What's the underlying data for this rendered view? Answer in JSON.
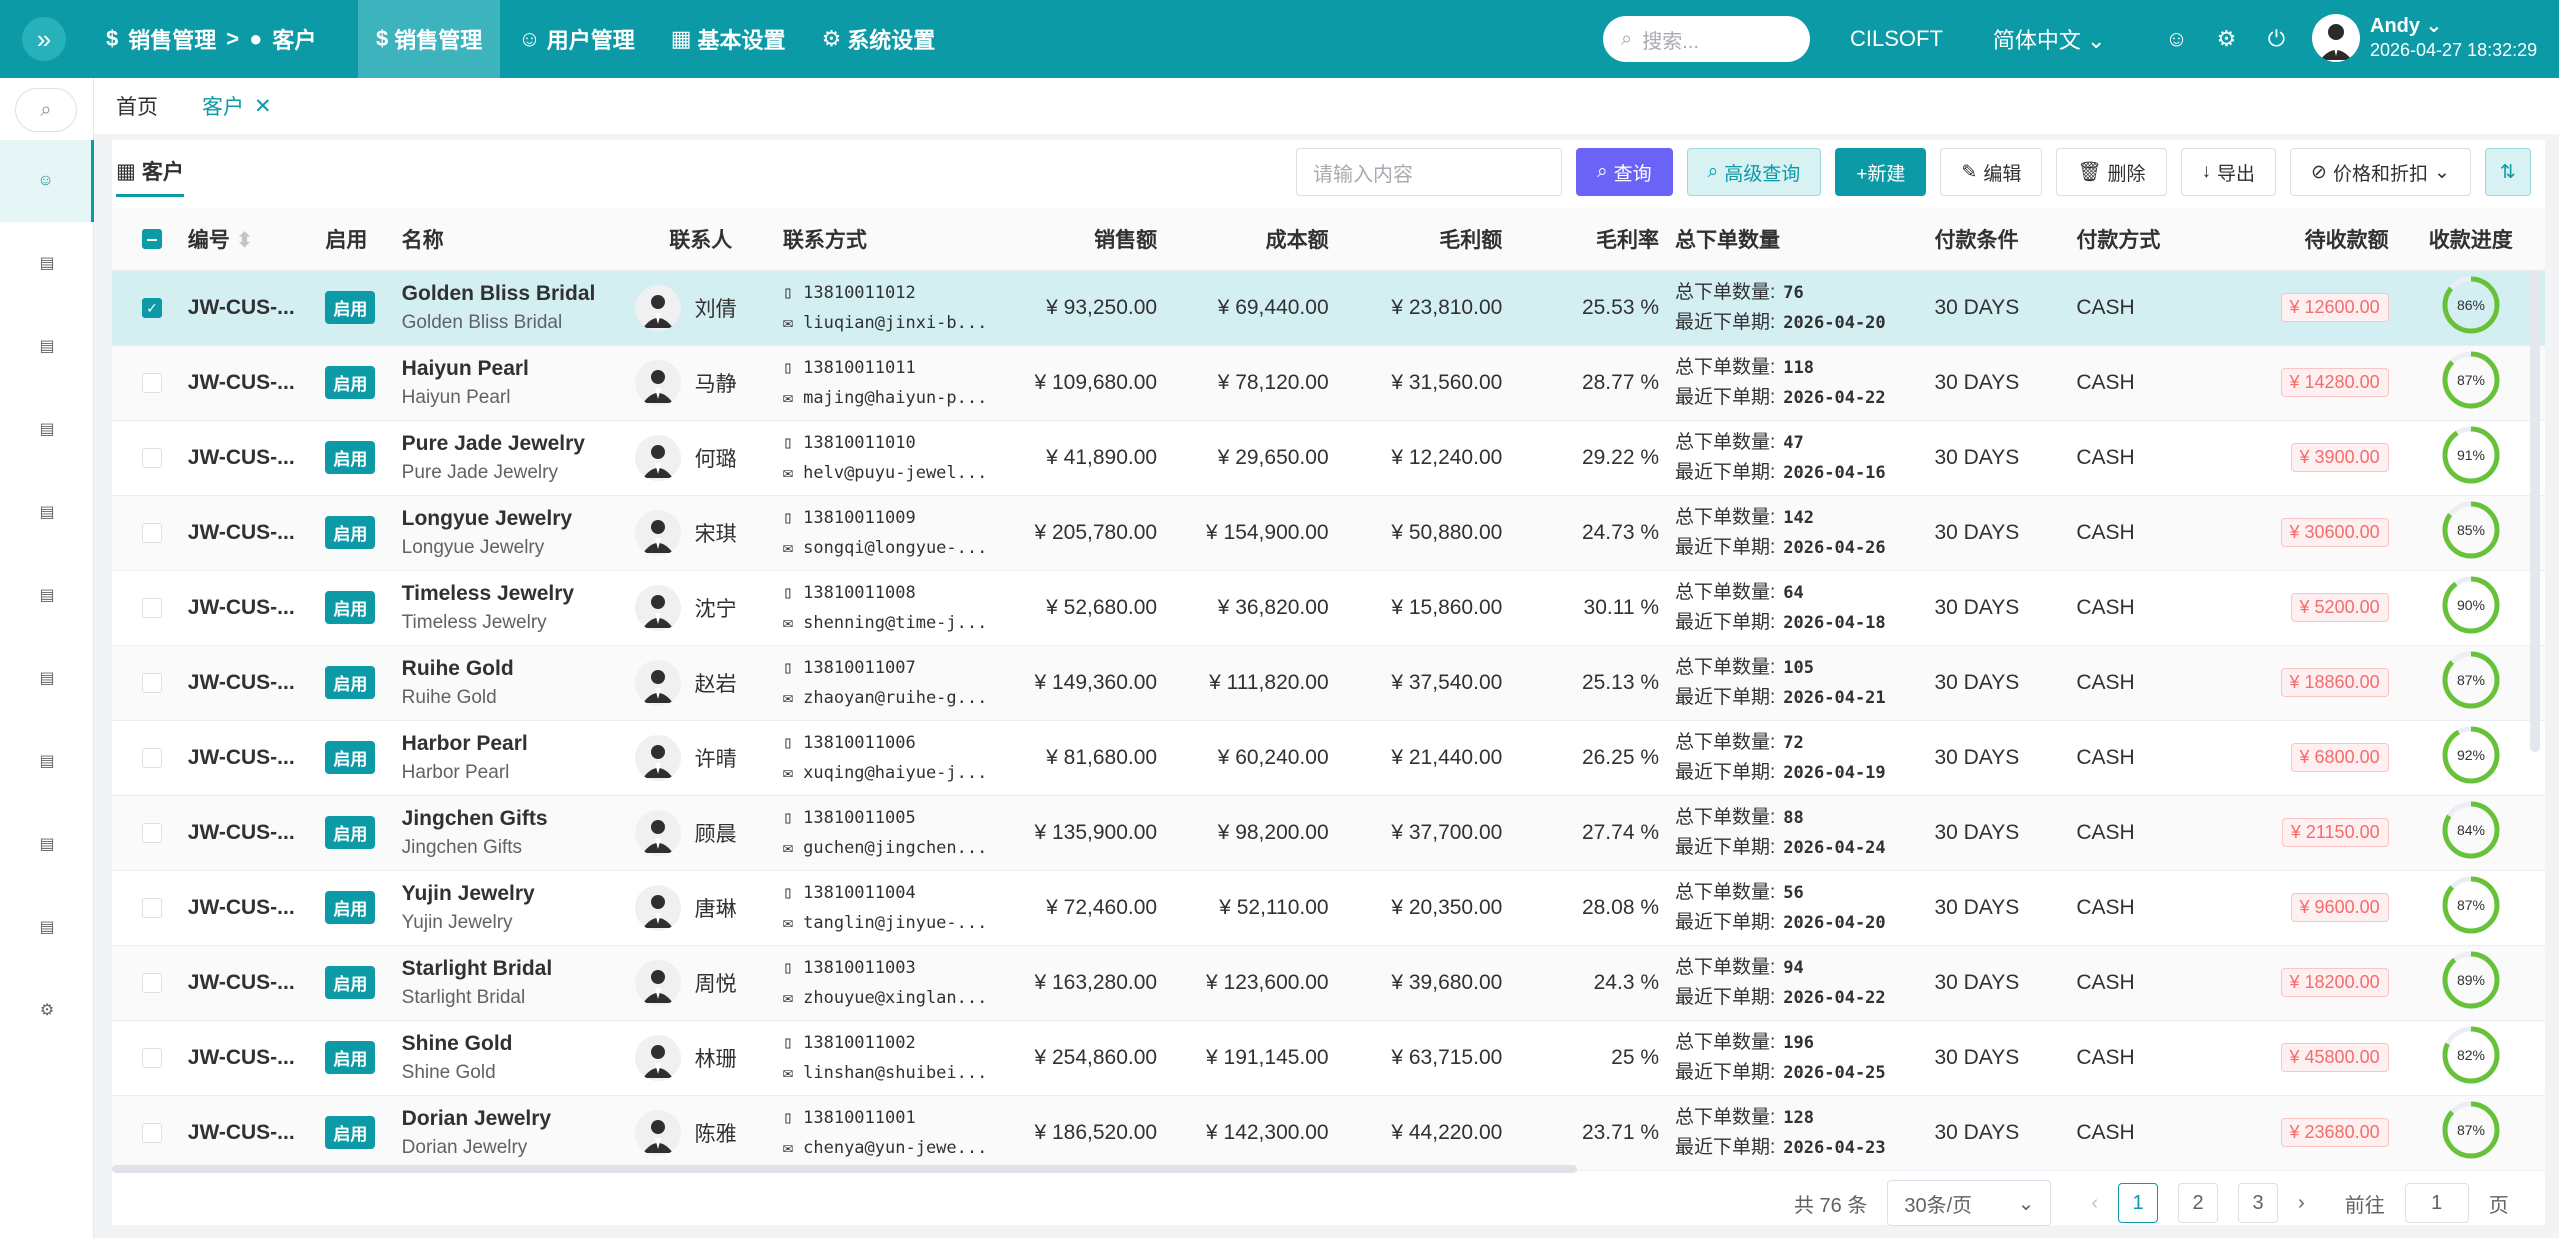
{
  "header": {
    "breadcrumb": [
      "销售管理",
      ">",
      "客户"
    ],
    "menu": [
      {
        "label": "销售管理",
        "icon": "dollar-circle-icon",
        "active": true
      },
      {
        "label": "用户管理",
        "icon": "user-icon",
        "active": false
      },
      {
        "label": "基本设置",
        "icon": "grid-icon",
        "active": false
      },
      {
        "label": "系统设置",
        "icon": "gear-icon",
        "active": false
      }
    ],
    "search_placeholder": "搜索...",
    "brand": "CILSOFT",
    "language": "简体中文",
    "user_name": "Andy",
    "datetime": "2026-04-27 18:32:29"
  },
  "tabs": [
    {
      "label": "首页",
      "active": false
    },
    {
      "label": "客户",
      "active": true
    }
  ],
  "panel": {
    "title": "客户",
    "input_placeholder": "请输入内容",
    "buttons": {
      "query": "查询",
      "advanced": "高级查询",
      "new": "+新建",
      "edit": "编辑",
      "delete": "删除",
      "export": "导出",
      "price": "价格和折扣"
    }
  },
  "table": {
    "columns": [
      "编号",
      "启用",
      "名称",
      "联系人",
      "联系方式",
      "销售额",
      "成本额",
      "毛利额",
      "毛利率",
      "总下单数量",
      "付款条件",
      "付款方式",
      "待收款额",
      "收款进度"
    ],
    "order_count_label": "总下单数量:",
    "last_order_label": "最近下单期:",
    "rows": [
      {
        "code": "JW-CUS-...",
        "status": "启用",
        "name": "Golden Bliss Bridal",
        "name2": "Golden Bliss Bridal",
        "contact": "刘倩",
        "phone": "13810011012",
        "email": "liuqian@jinxi-b...",
        "sales": "¥ 93,250.00",
        "cost": "¥ 69,440.00",
        "profit": "¥ 23,810.00",
        "margin": "25.53 %",
        "orders": "76",
        "last": "2026-04-20",
        "terms": "30 DAYS",
        "method": "CASH",
        "due": "¥ 12600.00",
        "progress": 86,
        "selected": true
      },
      {
        "code": "JW-CUS-...",
        "status": "启用",
        "name": "Haiyun Pearl",
        "name2": "Haiyun Pearl",
        "contact": "马静",
        "phone": "13810011011",
        "email": "majing@haiyun-p...",
        "sales": "¥ 109,680.00",
        "cost": "¥ 78,120.00",
        "profit": "¥ 31,560.00",
        "margin": "28.77 %",
        "orders": "118",
        "last": "2026-04-22",
        "terms": "30 DAYS",
        "method": "CASH",
        "due": "¥ 14280.00",
        "progress": 87,
        "selected": false
      },
      {
        "code": "JW-CUS-...",
        "status": "启用",
        "name": "Pure Jade Jewelry",
        "name2": "Pure Jade Jewelry",
        "contact": "何璐",
        "phone": "13810011010",
        "email": "helv@puyu-jewel...",
        "sales": "¥ 41,890.00",
        "cost": "¥ 29,650.00",
        "profit": "¥ 12,240.00",
        "margin": "29.22 %",
        "orders": "47",
        "last": "2026-04-16",
        "terms": "30 DAYS",
        "method": "CASH",
        "due": "¥ 3900.00",
        "progress": 91,
        "selected": false
      },
      {
        "code": "JW-CUS-...",
        "status": "启用",
        "name": "Longyue Jewelry",
        "name2": "Longyue Jewelry",
        "contact": "宋琪",
        "phone": "13810011009",
        "email": "songqi@longyue-...",
        "sales": "¥ 205,780.00",
        "cost": "¥ 154,900.00",
        "profit": "¥ 50,880.00",
        "margin": "24.73 %",
        "orders": "142",
        "last": "2026-04-26",
        "terms": "30 DAYS",
        "method": "CASH",
        "due": "¥ 30600.00",
        "progress": 85,
        "selected": false
      },
      {
        "code": "JW-CUS-...",
        "status": "启用",
        "name": "Timeless Jewelry",
        "name2": "Timeless Jewelry",
        "contact": "沈宁",
        "phone": "13810011008",
        "email": "shenning@time-j...",
        "sales": "¥ 52,680.00",
        "cost": "¥ 36,820.00",
        "profit": "¥ 15,860.00",
        "margin": "30.11 %",
        "orders": "64",
        "last": "2026-04-18",
        "terms": "30 DAYS",
        "method": "CASH",
        "due": "¥ 5200.00",
        "progress": 90,
        "selected": false
      },
      {
        "code": "JW-CUS-...",
        "status": "启用",
        "name": "Ruihe Gold",
        "name2": "Ruihe Gold",
        "contact": "赵岩",
        "phone": "13810011007",
        "email": "zhaoyan@ruihe-g...",
        "sales": "¥ 149,360.00",
        "cost": "¥ 111,820.00",
        "profit": "¥ 37,540.00",
        "margin": "25.13 %",
        "orders": "105",
        "last": "2026-04-21",
        "terms": "30 DAYS",
        "method": "CASH",
        "due": "¥ 18860.00",
        "progress": 87,
        "selected": false
      },
      {
        "code": "JW-CUS-...",
        "status": "启用",
        "name": "Harbor Pearl",
        "name2": "Harbor Pearl",
        "contact": "许晴",
        "phone": "13810011006",
        "email": "xuqing@haiyue-j...",
        "sales": "¥ 81,680.00",
        "cost": "¥ 60,240.00",
        "profit": "¥ 21,440.00",
        "margin": "26.25 %",
        "orders": "72",
        "last": "2026-04-19",
        "terms": "30 DAYS",
        "method": "CASH",
        "due": "¥ 6800.00",
        "progress": 92,
        "selected": false
      },
      {
        "code": "JW-CUS-...",
        "status": "启用",
        "name": "Jingchen Gifts",
        "name2": "Jingchen Gifts",
        "contact": "顾晨",
        "phone": "13810011005",
        "email": "guchen@jingchen...",
        "sales": "¥ 135,900.00",
        "cost": "¥ 98,200.00",
        "profit": "¥ 37,700.00",
        "margin": "27.74 %",
        "orders": "88",
        "last": "2026-04-24",
        "terms": "30 DAYS",
        "method": "CASH",
        "due": "¥ 21150.00",
        "progress": 84,
        "selected": false
      },
      {
        "code": "JW-CUS-...",
        "status": "启用",
        "name": "Yujin Jewelry",
        "name2": "Yujin Jewelry",
        "contact": "唐琳",
        "phone": "13810011004",
        "email": "tanglin@jinyue-...",
        "sales": "¥ 72,460.00",
        "cost": "¥ 52,110.00",
        "profit": "¥ 20,350.00",
        "margin": "28.08 %",
        "orders": "56",
        "last": "2026-04-20",
        "terms": "30 DAYS",
        "method": "CASH",
        "due": "¥ 9600.00",
        "progress": 87,
        "selected": false
      },
      {
        "code": "JW-CUS-...",
        "status": "启用",
        "name": "Starlight Bridal",
        "name2": "Starlight Bridal",
        "contact": "周悦",
        "phone": "13810011003",
        "email": "zhouyue@xinglan...",
        "sales": "¥ 163,280.00",
        "cost": "¥ 123,600.00",
        "profit": "¥ 39,680.00",
        "margin": "24.3 %",
        "orders": "94",
        "last": "2026-04-22",
        "terms": "30 DAYS",
        "method": "CASH",
        "due": "¥ 18200.00",
        "progress": 89,
        "selected": false
      },
      {
        "code": "JW-CUS-...",
        "status": "启用",
        "name": "Shine Gold",
        "name2": "Shine Gold",
        "contact": "林珊",
        "phone": "13810011002",
        "email": "linshan@shuibei...",
        "sales": "¥ 254,860.00",
        "cost": "¥ 191,145.00",
        "profit": "¥ 63,715.00",
        "margin": "25 %",
        "orders": "196",
        "last": "2026-04-25",
        "terms": "30 DAYS",
        "method": "CASH",
        "due": "¥ 45800.00",
        "progress": 82,
        "selected": false
      },
      {
        "code": "JW-CUS-...",
        "status": "启用",
        "name": "Dorian Jewelry",
        "name2": "Dorian Jewelry",
        "contact": "陈雅",
        "phone": "13810011001",
        "email": "chenya@yun-jewe...",
        "sales": "¥ 186,520.00",
        "cost": "¥ 142,300.00",
        "profit": "¥ 44,220.00",
        "margin": "23.71 %",
        "orders": "128",
        "last": "2026-04-23",
        "terms": "30 DAYS",
        "method": "CASH",
        "due": "¥ 23680.00",
        "progress": 87,
        "selected": false
      }
    ]
  },
  "pagination": {
    "total": "共 76 条",
    "page_size": "30条/页",
    "pages": [
      "1",
      "2",
      "3"
    ],
    "current": "1",
    "goto_label": "前往",
    "goto_value": "1",
    "page_suffix": "页"
  },
  "colors": {
    "primary": "#0b9aa6",
    "query": "#6a63f6",
    "progress": "#67c23a",
    "danger": "#f56c6c"
  }
}
